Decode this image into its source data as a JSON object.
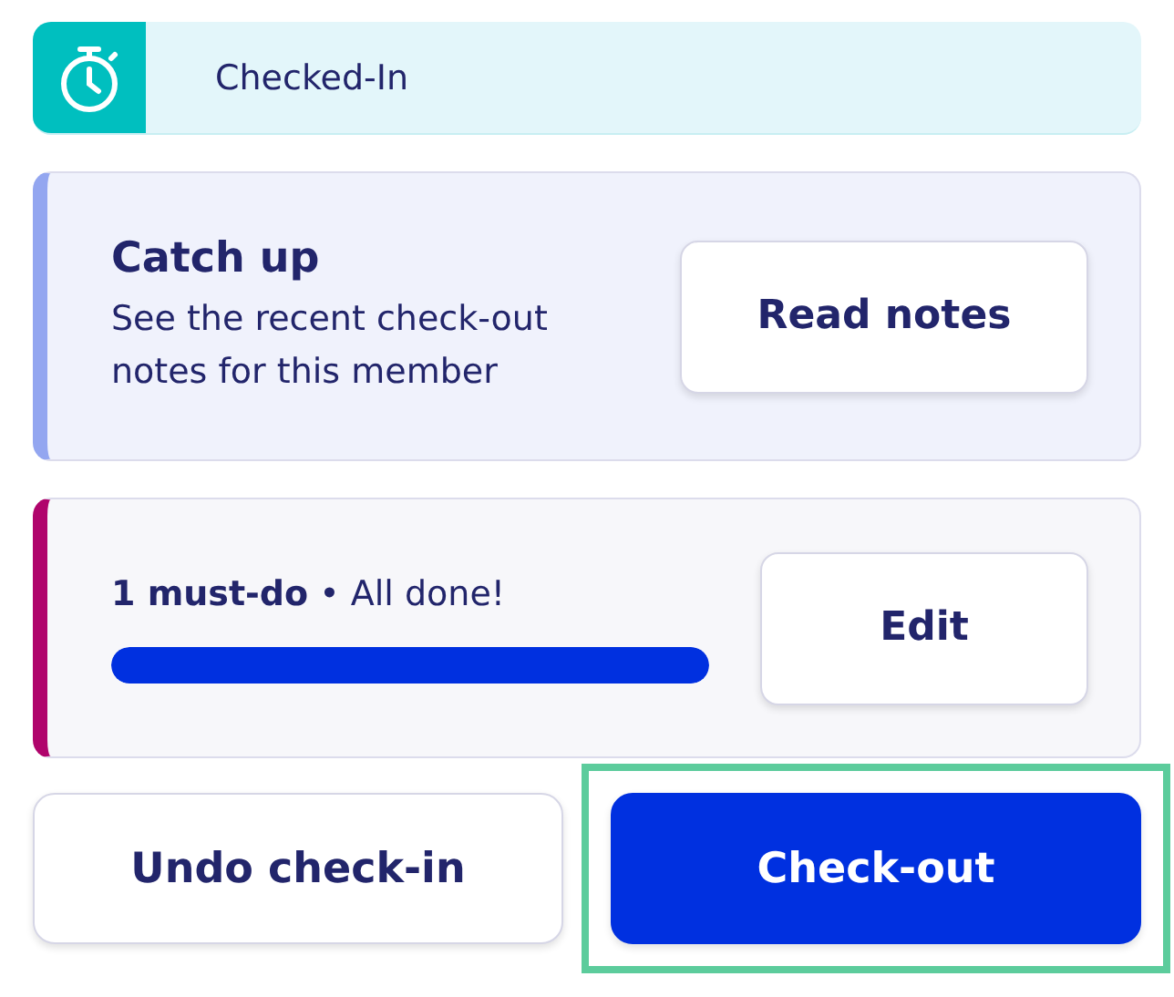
{
  "status": {
    "label": "Checked-In"
  },
  "catch_up": {
    "title": "Catch up",
    "description": "See the recent check-out notes for this member",
    "button": "Read notes"
  },
  "must_do": {
    "summary": "**1 must-do** • All done!",
    "level": 1,
    "button": "Edit"
  },
  "actions": [
    {
      "label": "Undo check-in",
      "kind": "secondary",
      "highlighted": false
    },
    {
      "label": "Check-out",
      "kind": "primary",
      "highlighted": true
    }
  ]
}
